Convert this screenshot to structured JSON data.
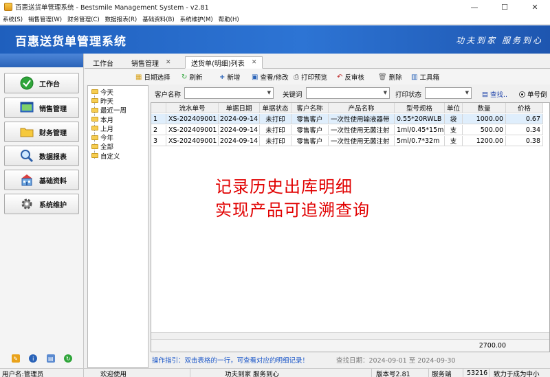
{
  "window": {
    "title": "百惠送货单管理系统 - Bestsmile Management System - v2.81",
    "min": "—",
    "max": "☐",
    "close": "✕"
  },
  "menu": [
    "系统(S)",
    "销售管理(W)",
    "财务管理(C)",
    "数据报表(R)",
    "基础资料(B)",
    "系统维护(M)",
    "帮助(H)"
  ],
  "banner": {
    "title": "百惠送货单管理系统",
    "slogan": "功夫到家 服务到心"
  },
  "sidebar": {
    "items": [
      {
        "label": "工作台",
        "icon": "check-circle-icon"
      },
      {
        "label": "销售管理",
        "icon": "window-icon"
      },
      {
        "label": "财务管理",
        "icon": "folder-icon"
      },
      {
        "label": "数据报表",
        "icon": "magnifier-icon"
      },
      {
        "label": "基础资料",
        "icon": "building-icon"
      },
      {
        "label": "系统维护",
        "icon": "gear-icon"
      }
    ]
  },
  "tabs": [
    {
      "label": "工作台"
    },
    {
      "label": "销售管理"
    },
    {
      "label": "送货单(明细)列表"
    }
  ],
  "toolbar": [
    "日期选择",
    "刷新",
    "新增",
    "查看/修改",
    "打印预览",
    "反审核",
    "删除",
    "工具箱"
  ],
  "tree": [
    "今天",
    "昨天",
    "最近一周",
    "本月",
    "上月",
    "今年",
    "全部",
    "自定义"
  ],
  "filter": {
    "customer_label": "客户名称",
    "customer_value": "",
    "keyword_label": "关键词",
    "keyword_value": "",
    "print_label": "打印状态",
    "print_value": "",
    "search_label": "查找..",
    "radio_label": "单号倒"
  },
  "grid": {
    "columns": [
      "",
      "流水单号",
      "单据日期",
      "单据状态",
      "客户名称",
      "产品名称",
      "型号规格",
      "单位",
      "数量",
      "价格"
    ],
    "rows": [
      [
        "1",
        "XS-202409001",
        "2024-09-14",
        "未打印",
        "零售客户",
        "一次性使用输液器带",
        "0.55*20RWLB",
        "袋",
        "1000.00",
        "0.67"
      ],
      [
        "2",
        "XS-202409001",
        "2024-09-14",
        "未打印",
        "零售客户",
        "一次性使用无菌注射",
        "1ml/0.45*15m",
        "支",
        "500.00",
        "0.34"
      ],
      [
        "3",
        "XS-202409001",
        "2024-09-14",
        "未打印",
        "零售客户",
        "一次性使用无菌注射",
        "5ml/0.7*32m",
        "支",
        "1200.00",
        "0.38"
      ]
    ],
    "total_quantity": "2700.00"
  },
  "annotation": {
    "line1": "记录历史出库明细",
    "line2": "实现产品可追溯查询"
  },
  "hint": "操作指引：双击表格的一行，可查看对应的明细记录！",
  "date_range": "查找日期：2024-09-01 至 2024-09-30",
  "status": {
    "user": "用户名:管理员",
    "welcome": "欢迎使用",
    "slogan": "功夫到家 服务到心",
    "version": "版本号2.81",
    "service": "服务端",
    "code": "53216",
    "mission": "致力于成为中小"
  },
  "colors": {
    "banner": "#2d74d4",
    "annotation": "#e10000",
    "hint": "#1a56c8"
  }
}
